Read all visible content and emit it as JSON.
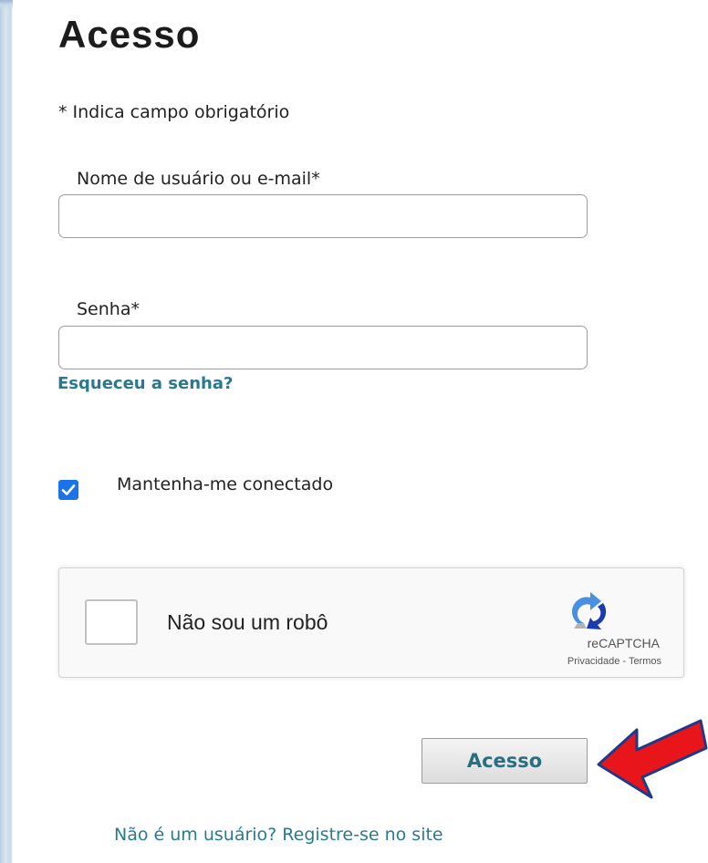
{
  "page": {
    "title": "Acesso",
    "required_note": "* Indica campo obrigatório"
  },
  "form": {
    "username": {
      "label": "Nome de usuário ou e-mail*",
      "value": "",
      "placeholder": ""
    },
    "password": {
      "label": "Senha*",
      "value": "",
      "placeholder": ""
    },
    "forgot_link": "Esqueceu a senha?",
    "keep_connected": {
      "label": "Mantenha-me conectado",
      "checked": true
    }
  },
  "recaptcha": {
    "label": "Não sou um robô",
    "brand": "reCAPTCHA",
    "privacy": "Privacidade",
    "separator": " - ",
    "terms": "Termos"
  },
  "submit_label": "Acesso",
  "register_link": "Não é um usuário? Registre-se no site",
  "colors": {
    "link": "#2a7a8e",
    "checkbox": "#1a73e8",
    "arrow": "#e8161a"
  },
  "icons": {
    "check": "check-icon",
    "recaptcha_logo": "recaptcha-logo-icon",
    "annotation_arrow": "red-arrow-icon"
  }
}
